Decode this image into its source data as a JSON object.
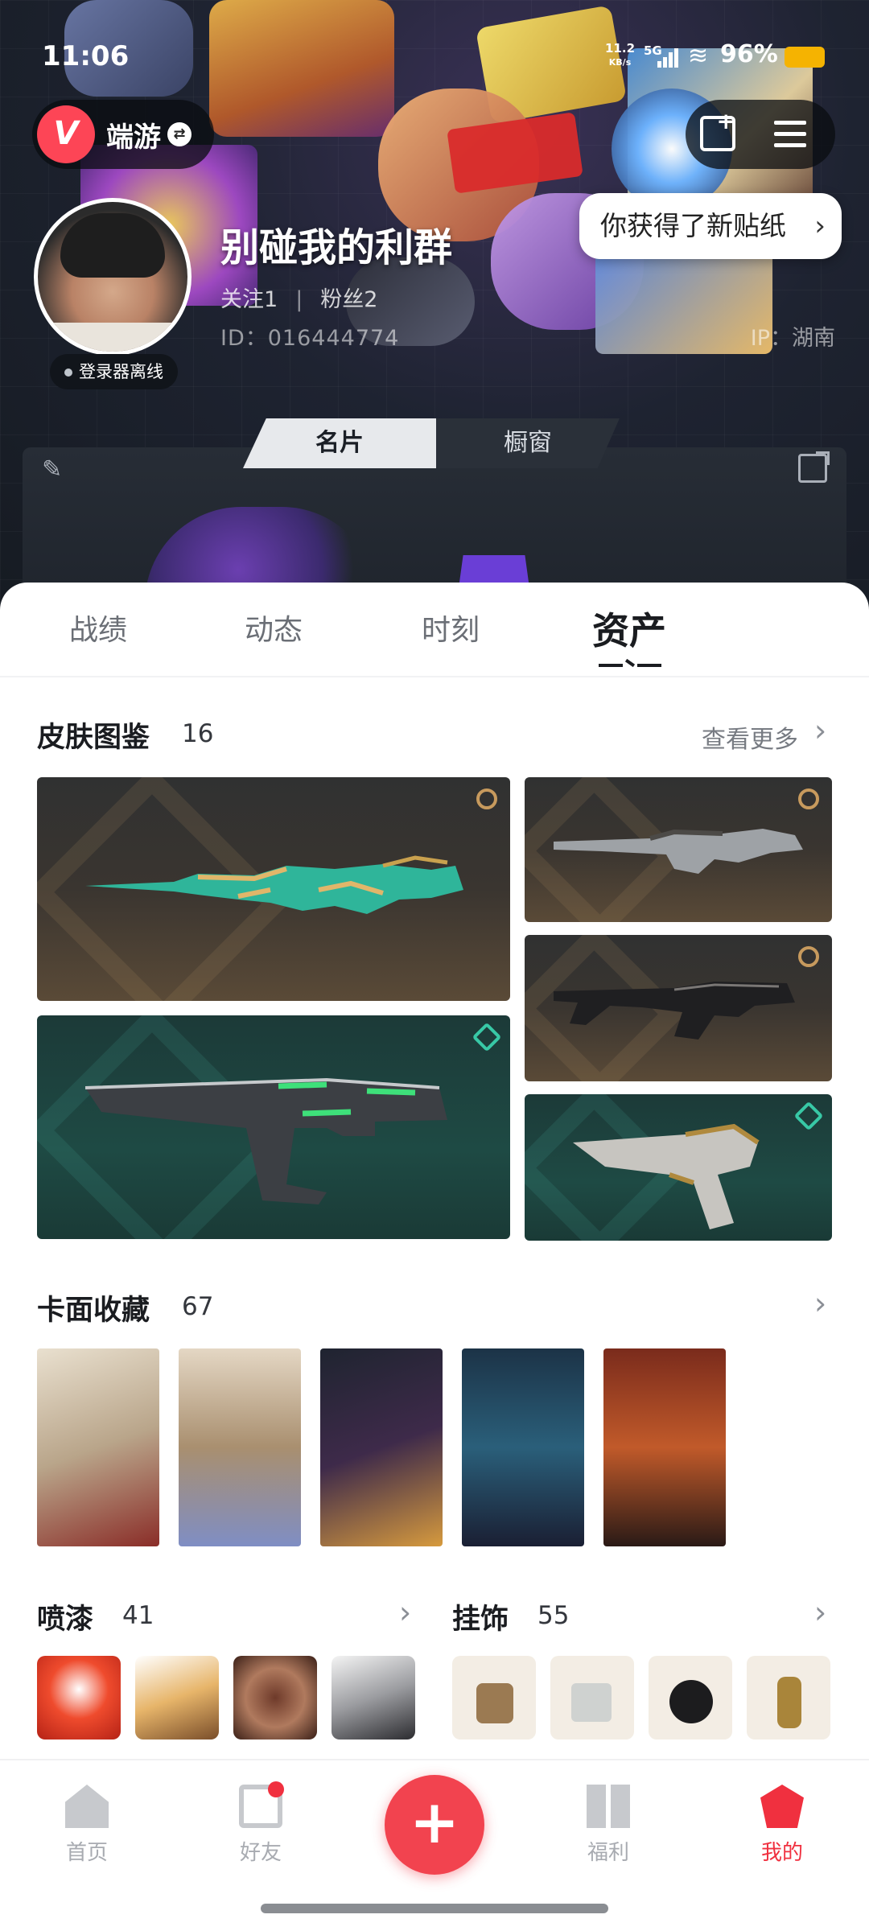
{
  "status_bar": {
    "time": "11:06",
    "net_speed_value": "11.2",
    "net_speed_unit": "KB/s",
    "signal_label": "5G",
    "battery": "96%"
  },
  "header": {
    "brand_name": "端游",
    "toast": "你获得了新贴纸",
    "nickname": "别碰我的利群",
    "follow_label": "关注1",
    "fans_label": "粉丝2",
    "separator": "|",
    "uid": "ID：016444774",
    "ip": "IP：湖南",
    "online_status": "登录器离线",
    "card_tabs": [
      "名片",
      "橱窗"
    ]
  },
  "tabs": [
    {
      "label": "战绩",
      "active": false
    },
    {
      "label": "动态",
      "active": false
    },
    {
      "label": "时刻",
      "active": false
    },
    {
      "label": "资产",
      "active": true
    }
  ],
  "skins": {
    "title": "皮肤图鉴",
    "count": "16",
    "more": "查看更多"
  },
  "cards": {
    "title": "卡面收藏",
    "count": "67"
  },
  "sprays": {
    "title": "喷漆",
    "count": "41"
  },
  "charms": {
    "title": "挂饰",
    "count": "55"
  },
  "bottom_nav": {
    "items": [
      {
        "label": "首页",
        "icon": "home-icon"
      },
      {
        "label": "好友",
        "icon": "friends-icon"
      },
      {
        "label": "",
        "icon": "plus-icon"
      },
      {
        "label": "福利",
        "icon": "gift-icon"
      },
      {
        "label": "我的",
        "icon": "profile-icon"
      }
    ],
    "fab_symbol": "+"
  },
  "colors": {
    "accent": "#f2434f",
    "brand": "#fd4556",
    "battery": "#f5b301"
  }
}
